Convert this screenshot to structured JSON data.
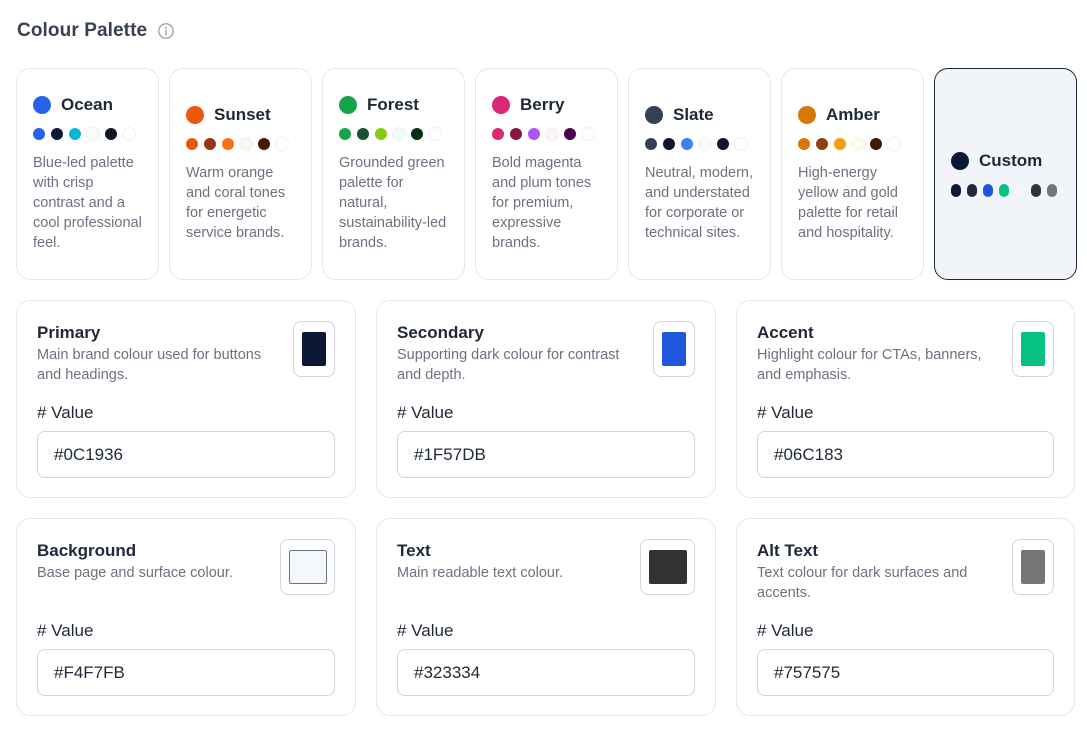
{
  "header": {
    "title": "Colour Palette",
    "info_icon": "info-circle-icon"
  },
  "palettes": [
    {
      "name": "Ocean",
      "dot": "#2563eb",
      "swatches": [
        "#2563eb",
        "#0c1936",
        "#06b6d4",
        "#f8fafc",
        "#0f172a",
        "#ffffff"
      ],
      "description": "Blue-led palette with crisp contrast and a cool professional feel."
    },
    {
      "name": "Sunset",
      "dot": "#ea580c",
      "swatches": [
        "#ea580c",
        "#9a3412",
        "#f97316",
        "#fff7ed",
        "#451a03",
        "#ffffff"
      ],
      "description": "Warm orange and coral tones for energetic service brands."
    },
    {
      "name": "Forest",
      "dot": "#16a34a",
      "swatches": [
        "#16a34a",
        "#14532d",
        "#84cc16",
        "#f0fdf4",
        "#052e16",
        "#ffffff"
      ],
      "description": "Grounded green palette for natural, sustainability-led brands."
    },
    {
      "name": "Berry",
      "dot": "#db2777",
      "swatches": [
        "#db2777",
        "#831843",
        "#a855f7",
        "#fdf2f8",
        "#4a044e",
        "#ffffff"
      ],
      "description": "Bold magenta and plum tones for premium, expressive brands."
    },
    {
      "name": "Slate",
      "dot": "#334155",
      "swatches": [
        "#334155",
        "#0f172a",
        "#3b82f6",
        "#f8fafc",
        "#0f172a",
        "#ffffff"
      ],
      "description": "Neutral, modern, and understated for corporate or technical sites."
    },
    {
      "name": "Amber",
      "dot": "#d97706",
      "swatches": [
        "#d97706",
        "#92400e",
        "#f59e0b",
        "#fffbeb",
        "#451a03",
        "#ffffff"
      ],
      "description": "High-energy yellow and gold palette for retail and hospitality."
    },
    {
      "name": "Custom",
      "dot": "#0c1936",
      "swatches": [
        "#0c1936",
        "#1e293b",
        "#1f57db",
        "#06c183",
        "#f4f7fb",
        "#323334",
        "#757575"
      ],
      "description": ""
    }
  ],
  "colors": [
    {
      "title": "Primary",
      "description": "Main brand colour used for buttons and headings.",
      "value_label": "# Value",
      "value": "#0C1936",
      "hex": "#0c1936"
    },
    {
      "title": "Secondary",
      "description": "Supporting dark colour for contrast and depth.",
      "value_label": "# Value",
      "value": "#1F57DB",
      "hex": "#1f57db"
    },
    {
      "title": "Accent",
      "description": "Highlight colour for CTAs, banners, and emphasis.",
      "value_label": "# Value",
      "value": "#06C183",
      "hex": "#06c183"
    },
    {
      "title": "Background",
      "description": "Base page and surface colour.",
      "value_label": "# Value",
      "value": "#F4F7FB",
      "hex": "#f4f7fb"
    },
    {
      "title": "Text",
      "description": "Main readable text colour.",
      "value_label": "# Value",
      "value": "#323334",
      "hex": "#323334"
    },
    {
      "title": "Alt Text",
      "description": "Text colour for dark surfaces and accents.",
      "value_label": "# Value",
      "value": "#757575",
      "hex": "#757575"
    }
  ]
}
